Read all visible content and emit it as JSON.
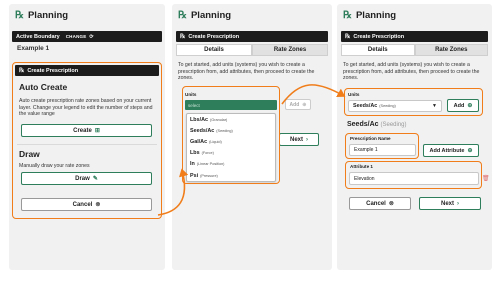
{
  "app_title": "Planning",
  "panel1": {
    "bar_label": "Active Boundary",
    "change_label": "CHANGE",
    "boundary_name": "Example 1",
    "section_title": "Create Prescription",
    "auto_title": "Auto Create",
    "auto_desc": "Auto create prescription rate zones based on your current layer. Change your legend to edit the number of steps and the value range",
    "create_btn": "Create",
    "draw_title": "Draw",
    "draw_desc": "Manually draw your rate zones",
    "draw_btn": "Draw",
    "cancel_btn": "Cancel"
  },
  "panel2": {
    "section_title": "Create Prescription",
    "tabs": [
      "Details",
      "Rate Zones"
    ],
    "intro": "To get started, add units (systems) you wish to create a prescription from, add attributes, then proceed to create the zones.",
    "units_label": "Units",
    "select_placeholder": "select",
    "add_btn": "Add",
    "next_btn": "Next",
    "options": [
      {
        "label": "Lbs/Ac",
        "note": "(Granular)"
      },
      {
        "label": "Seeds/Ac",
        "note": "(Seeding)"
      },
      {
        "label": "Gal/Ac",
        "note": "(Liquid)"
      },
      {
        "label": "Lbs",
        "note": "(Force)"
      },
      {
        "label": "In",
        "note": "(Linear Position)"
      },
      {
        "label": "Psi",
        "note": "(Pressure)"
      }
    ]
  },
  "panel3": {
    "section_title": "Create Prescription",
    "tabs": [
      "Details",
      "Rate Zones"
    ],
    "intro": "To get started, add units (systems) you wish to create a prescription from, add attributes, then proceed to create the zones.",
    "units_label": "Units",
    "unit_value": "Seeds/Ac",
    "unit_note": "(Seeding)",
    "add_btn": "Add",
    "unit_heading": "Seeds/Ac",
    "unit_heading_note": "(Seeding)",
    "rx_name_label": "Prescription Name",
    "rx_name_value": "Example 1",
    "add_attribute_btn": "Add Attribute",
    "attribute_label": "Attribute 1",
    "attribute_value": "Elevation",
    "cancel_btn": "Cancel",
    "next_btn": "Next"
  },
  "colors": {
    "accent_green": "#2e7d5b",
    "highlight_orange": "#f07d1a",
    "dark_bar": "#1c1c1c",
    "panel_bg": "#f1f1f1",
    "delete_red": "#e06b6b"
  },
  "icons": [
    "rx-logo-icon",
    "refresh-icon",
    "plus-square-icon",
    "pencil-icon",
    "close-circle-icon",
    "plus-circle-icon",
    "chevron-right-icon",
    "caret-down-icon",
    "trash-icon",
    "arrow-icon"
  ]
}
